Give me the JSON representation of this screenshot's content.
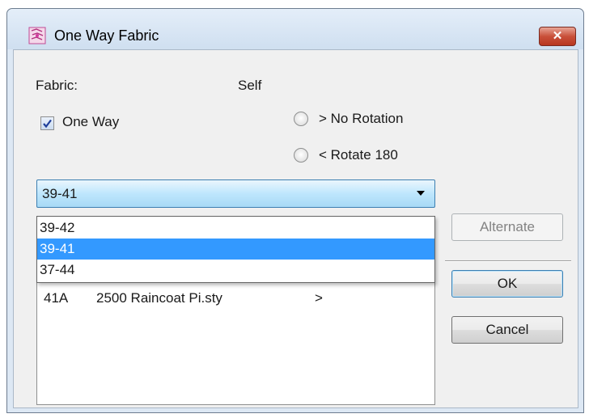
{
  "window": {
    "title": "One Way Fabric",
    "close_label": "✕"
  },
  "fabric": {
    "label": "Fabric:",
    "value": "Self"
  },
  "one_way": {
    "label": "One Way",
    "checked": true
  },
  "rotation": {
    "no_rotation": "> No Rotation",
    "rotate_180": "< Rotate 180"
  },
  "combo": {
    "selected": "39-41",
    "options": [
      "39-42",
      "39-41",
      "37-44"
    ]
  },
  "list": {
    "rows": [
      {
        "code": "41A",
        "name": "2500 Raincoat Pi.sty",
        "dir": ">"
      }
    ]
  },
  "buttons": {
    "alternate": "Alternate",
    "ok": "OK",
    "cancel": "Cancel"
  },
  "colors": {
    "selection": "#3399ff",
    "close": "#c9503a"
  }
}
